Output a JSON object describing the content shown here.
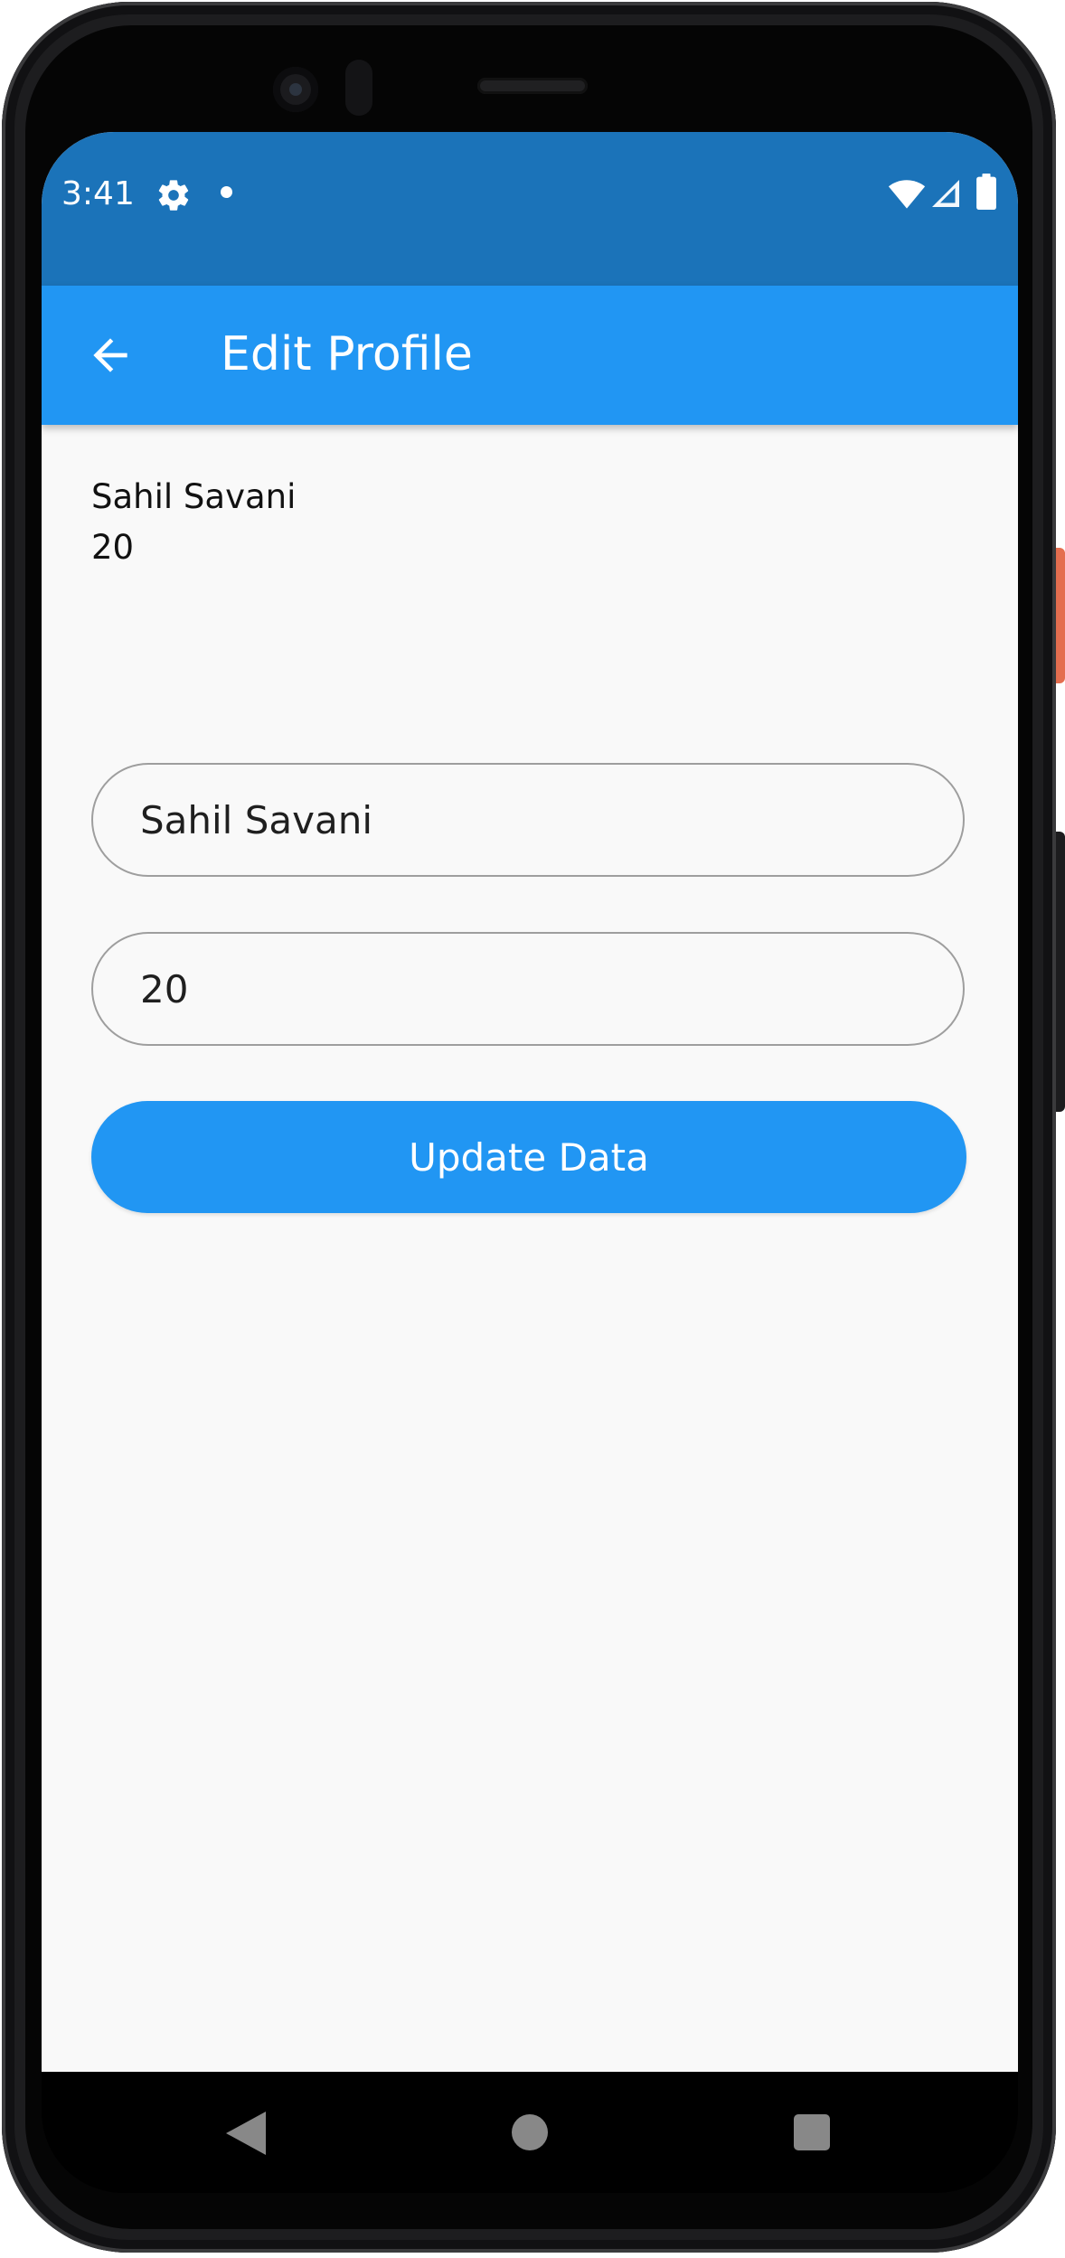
{
  "status_bar": {
    "time": "3:41",
    "icons": [
      "gear-icon",
      "notification-dot-icon",
      "wifi-icon",
      "signal-icon",
      "battery-icon"
    ],
    "background_color": "#1b73b9"
  },
  "app_bar": {
    "title": "Edit Profile",
    "back_icon": "arrow-back-icon",
    "background_color": "#2196f3"
  },
  "profile": {
    "name": "Sahil Savani",
    "age": "20"
  },
  "form": {
    "name_value": "Sahil Savani",
    "age_value": "20",
    "update_button_label": "Update Data"
  },
  "nav_bar": {
    "icons": [
      "back-triangle-icon",
      "home-circle-icon",
      "recents-square-icon"
    ]
  }
}
